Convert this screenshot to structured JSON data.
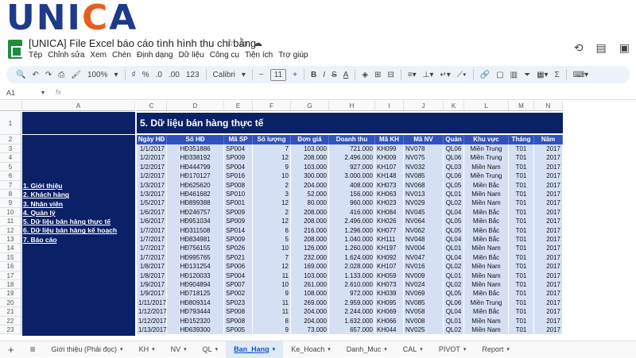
{
  "brand": {
    "logo_text_1": "UNI",
    "logo_text_2": "C",
    "logo_text_3": "A"
  },
  "window": {
    "title": "[UNICA] File Excel báo cáo tình hình thu chi bằng",
    "menu": [
      "Tệp",
      "Chỉnh sửa",
      "Xem",
      "Chèn",
      "Định dạng",
      "Dữ liệu",
      "Công cụ",
      "Tiện ích",
      "Trợ giúp"
    ]
  },
  "toolbar": {
    "zoom": "100%",
    "currency": "₫",
    "percent": "%",
    "dec_decrease": ".0",
    "dec_increase": ".00",
    "format_123": "123",
    "font": "Calibri",
    "font_size": "11"
  },
  "formula_bar": {
    "cell_ref": "A1",
    "fx": "fx"
  },
  "columns": [
    "A",
    "C",
    "D",
    "E",
    "F",
    "G",
    "H",
    "I",
    "J",
    "K",
    "L",
    "M",
    "N"
  ],
  "rows": [
    "1",
    "2",
    "3",
    "4",
    "5",
    "6",
    "7",
    "8",
    "9",
    "10",
    "11",
    "12",
    "13",
    "14",
    "15",
    "16",
    "17",
    "18",
    "19",
    "20",
    "21",
    "22",
    "23"
  ],
  "nav_links": [
    "1. Giới thiệu",
    "2. Khách hàng",
    "3. Nhân viên",
    "4. Quản lý",
    "5. Dữ liệu bán hàng thực tế",
    "6. Dữ liệu bán hàng kế hoạch",
    "7. Báo cáo"
  ],
  "sheet": {
    "section_title": "5. Dữ liệu bán hàng thực tế",
    "headers": [
      "Ngày HĐ",
      "Số HĐ",
      "Mã SP",
      "Số lượng",
      "Đơn giá",
      "Doanh thu",
      "Mã KH",
      "Mã NV",
      "Quản lý",
      "Khu vực",
      "Tháng",
      "Năm"
    ],
    "rows": [
      [
        "1/1/2017",
        "HĐ351886",
        "SP004",
        "7",
        "103.000",
        "721.000",
        "KH099",
        "NV078",
        "QL06",
        "Miền Trung",
        "T01",
        "2017"
      ],
      [
        "1/2/2017",
        "HĐ338192",
        "SP009",
        "12",
        "208.000",
        "2.496.000",
        "KH009",
        "NV075",
        "QL06",
        "Miền Trung",
        "T01",
        "2017"
      ],
      [
        "1/2/2017",
        "HĐ444799",
        "SP004",
        "9",
        "103.000",
        "927.000",
        "KH107",
        "NV032",
        "QL03",
        "Miền Nam",
        "T01",
        "2017"
      ],
      [
        "1/2/2017",
        "HĐ170127",
        "SP016",
        "10",
        "300.000",
        "3.000.000",
        "KH148",
        "NV085",
        "QL06",
        "Miền Trung",
        "T01",
        "2017"
      ],
      [
        "1/3/2017",
        "HĐ625620",
        "SP008",
        "2",
        "204.000",
        "408.000",
        "KH073",
        "NV068",
        "QL05",
        "Miền Bắc",
        "T01",
        "2017"
      ],
      [
        "1/3/2017",
        "HĐ461682",
        "SP010",
        "3",
        "52.000",
        "156.000",
        "KH063",
        "NV013",
        "QL01",
        "Miền Nam",
        "T01",
        "2017"
      ],
      [
        "1/5/2017",
        "HĐ899388",
        "SP001",
        "12",
        "80.000",
        "960.000",
        "KH023",
        "NV029",
        "QL02",
        "Miền Nam",
        "T01",
        "2017"
      ],
      [
        "1/6/2017",
        "HĐ246757",
        "SP009",
        "2",
        "208.000",
        "416.000",
        "KH084",
        "NV045",
        "QL04",
        "Miền Bắc",
        "T01",
        "2017"
      ],
      [
        "1/6/2017",
        "HĐ951034",
        "SP009",
        "12",
        "208.000",
        "2.496.000",
        "KH026",
        "NV064",
        "QL05",
        "Miền Bắc",
        "T01",
        "2017"
      ],
      [
        "1/7/2017",
        "HĐ311508",
        "SP014",
        "6",
        "216.000",
        "1.296.000",
        "KH077",
        "NV062",
        "QL05",
        "Miền Bắc",
        "T01",
        "2017"
      ],
      [
        "1/7/2017",
        "HĐ834981",
        "SP009",
        "5",
        "208.000",
        "1.040.000",
        "KH111",
        "NV048",
        "QL04",
        "Miền Bắc",
        "T01",
        "2017"
      ],
      [
        "1/7/2017",
        "HĐ756155",
        "SP026",
        "10",
        "126.000",
        "1.260.000",
        "KH197",
        "NV004",
        "QL01",
        "Miền Nam",
        "T01",
        "2017"
      ],
      [
        "1/7/2017",
        "HĐ995765",
        "SP021",
        "7",
        "232.000",
        "1.624.000",
        "KH092",
        "NV047",
        "QL04",
        "Miền Bắc",
        "T01",
        "2017"
      ],
      [
        "1/8/2017",
        "HĐ131254",
        "SP006",
        "12",
        "169.000",
        "2.028.000",
        "KH107",
        "NV016",
        "QL02",
        "Miền Nam",
        "T01",
        "2017"
      ],
      [
        "1/8/2017",
        "HĐ120033",
        "SP004",
        "11",
        "103.000",
        "1.133.000",
        "KH059",
        "NV009",
        "QL01",
        "Miền Nam",
        "T01",
        "2017"
      ],
      [
        "1/9/2017",
        "HĐ904894",
        "SP007",
        "10",
        "261.000",
        "2.610.000",
        "KH073",
        "NV024",
        "QL02",
        "Miền Nam",
        "T01",
        "2017"
      ],
      [
        "1/9/2017",
        "HĐ718125",
        "SP002",
        "9",
        "108.000",
        "972.000",
        "KH039",
        "NV069",
        "QL05",
        "Miền Bắc",
        "T01",
        "2017"
      ],
      [
        "1/11/2017",
        "HĐ809314",
        "SP023",
        "11",
        "269.000",
        "2.959.000",
        "KH095",
        "NV085",
        "QL06",
        "Miền Trung",
        "T01",
        "2017"
      ],
      [
        "1/12/2017",
        "HĐ793444",
        "SP008",
        "11",
        "204.000",
        "2.244.000",
        "KH069",
        "NV058",
        "QL04",
        "Miền Bắc",
        "T01",
        "2017"
      ],
      [
        "1/12/2017",
        "HĐ152320",
        "SP008",
        "8",
        "204.000",
        "1.632.000",
        "KH066",
        "NV008",
        "QL01",
        "Miền Nam",
        "T01",
        "2017"
      ],
      [
        "1/13/2017",
        "HĐ639300",
        "SP005",
        "9",
        "73.000",
        "657.000",
        "KH044",
        "NV025",
        "QL02",
        "Miền Nam",
        "T01",
        "2017"
      ]
    ]
  },
  "tabs": [
    {
      "label": "Giới thiệu (Phải đọc)",
      "active": false
    },
    {
      "label": "KH",
      "active": false
    },
    {
      "label": "NV",
      "active": false
    },
    {
      "label": "QL",
      "active": false
    },
    {
      "label": "Ban_Hang",
      "active": true
    },
    {
      "label": "Ke_Hoach",
      "active": false
    },
    {
      "label": "Danh_Muc",
      "active": false
    },
    {
      "label": "CAL",
      "active": false
    },
    {
      "label": "PIVOT",
      "active": false
    },
    {
      "label": "Report",
      "active": false
    }
  ],
  "colors": {
    "navy": "#0b2166",
    "header_blue": "#2f52c0",
    "row_light": "#d6e0f5",
    "accent": "#0b57d0"
  }
}
